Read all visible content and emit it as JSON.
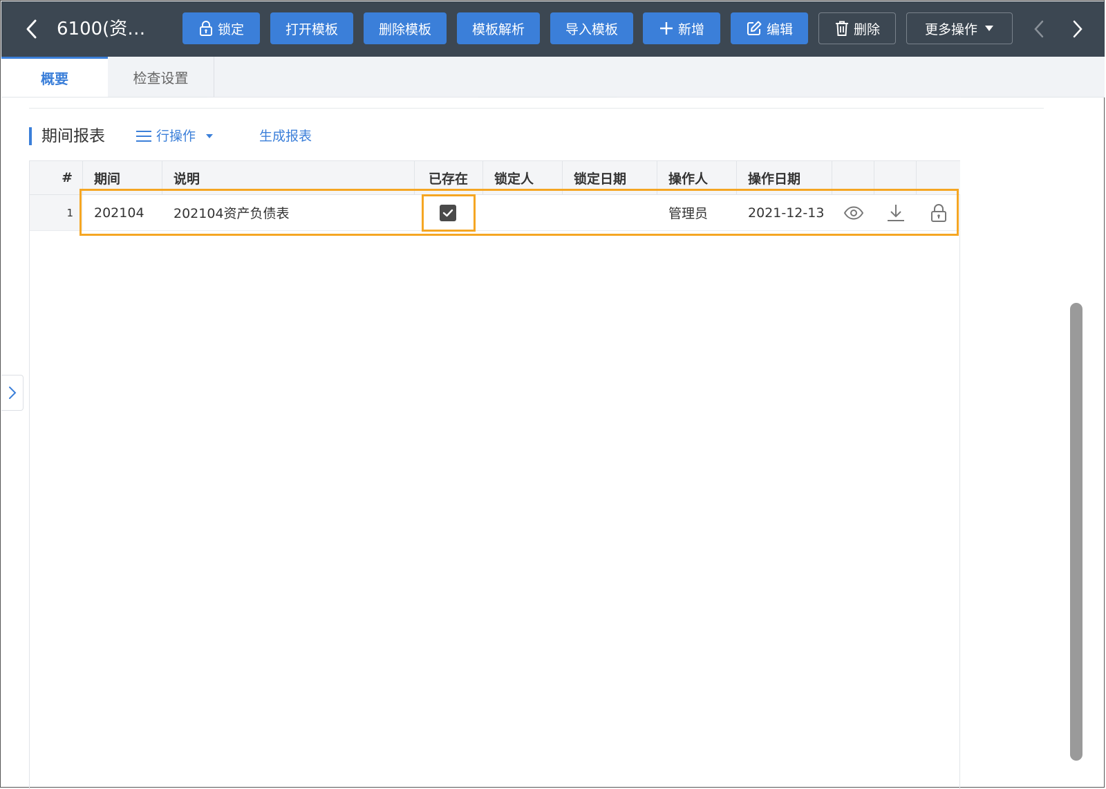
{
  "toolbar": {
    "title": "6100(资…",
    "buttons": {
      "lock": "锁定",
      "open_template": "打开模板",
      "delete_template": "删除模板",
      "parse_template": "模板解析",
      "import_template": "导入模板",
      "add": "新增",
      "edit": "编辑",
      "delete": "删除",
      "more_actions": "更多操作"
    }
  },
  "tabs": [
    {
      "label": "概要",
      "active": true
    },
    {
      "label": "检查设置",
      "active": false
    }
  ],
  "section": {
    "title": "期间报表",
    "row_ops_label": "行操作",
    "generate_report_label": "生成报表"
  },
  "table": {
    "columns": [
      "#",
      "期间",
      "说明",
      "已存在",
      "锁定人",
      "锁定日期",
      "操作人",
      "操作日期"
    ],
    "rows": [
      {
        "num": "1",
        "period": "202104",
        "description": "202104资产负债表",
        "exists": true,
        "lock_user": "",
        "lock_date": "",
        "operator": "管理员",
        "op_date": "2021-12-13"
      }
    ]
  },
  "colors": {
    "toolbar_bg": "#3c4752",
    "primary": "#3b7fd9",
    "highlight": "#f5a623"
  },
  "icons": [
    "chevron-left-icon",
    "lock-icon",
    "plus-icon",
    "edit-icon",
    "trash-icon",
    "caret-down-icon",
    "chevron-right-icon",
    "menu-icon",
    "checkmark-icon",
    "eye-icon",
    "download-icon"
  ]
}
